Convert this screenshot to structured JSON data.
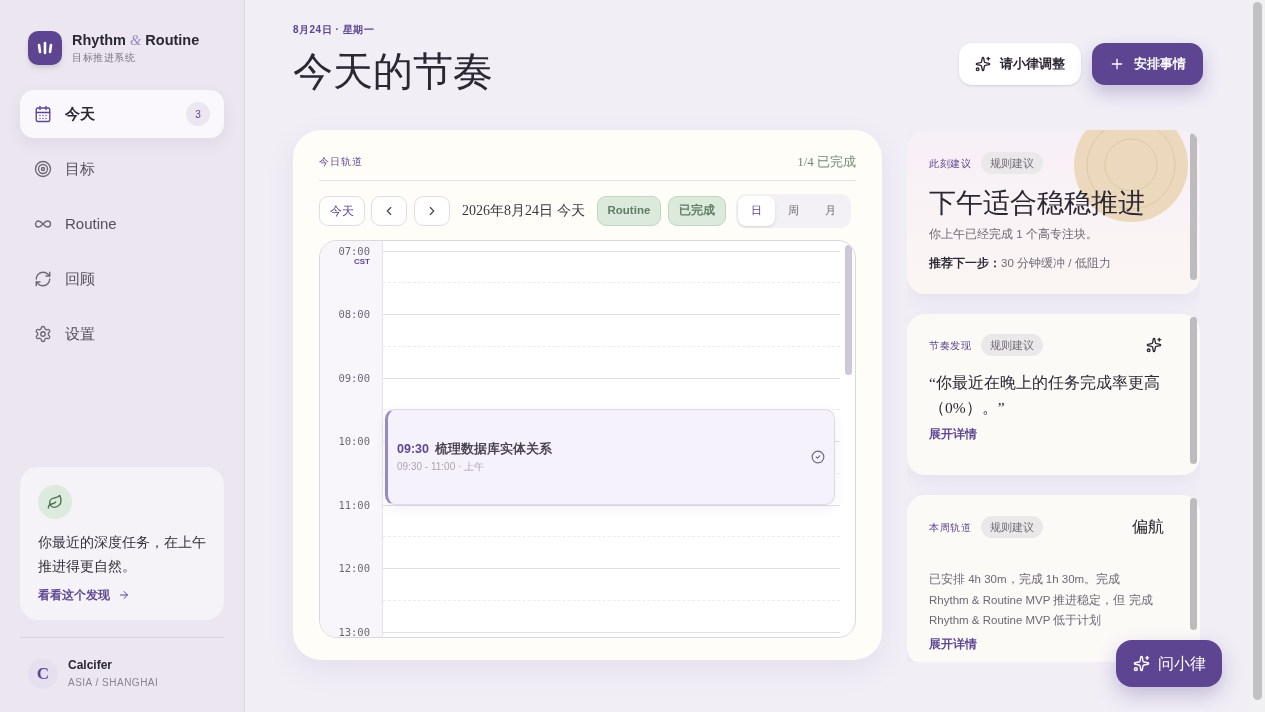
{
  "sidebar": {
    "brand": {
      "name_start": "Rhythm",
      "ampersand": "&",
      "name_end": "Routine",
      "subtitle": "目标推进系统"
    },
    "nav": [
      {
        "label": "今天",
        "badge": "3",
        "selected": true
      },
      {
        "label": "目标",
        "selected": false
      },
      {
        "label": "Routine",
        "selected": false
      },
      {
        "label": "回顾",
        "selected": false
      },
      {
        "label": "设置",
        "selected": false
      }
    ],
    "insight": {
      "text": "你最近的深度任务，在上午推进得更自然。",
      "link": "看看这个发现"
    },
    "user": {
      "initial": "C",
      "name": "Calcifer",
      "timezone": "ASIA / SHANGHAI"
    }
  },
  "header": {
    "date_line": "8月24日 · 星期一",
    "title": "今天的节奏",
    "buttons": [
      {
        "kind": "secondary",
        "label": "请小律调整"
      },
      {
        "kind": "primary",
        "label": "安排事情"
      }
    ]
  },
  "calendar": {
    "section_title": "今日轨道",
    "progress": "1/4 已完成",
    "today_button": "今天",
    "date": "2026年8月24日 今天",
    "filters": [
      "Routine",
      "已完成"
    ],
    "views": [
      {
        "label": "日",
        "selected": true
      },
      {
        "label": "周",
        "selected": false
      },
      {
        "label": "月",
        "selected": false
      }
    ],
    "timezone": "CST",
    "hours": [
      "07:00",
      "08:00",
      "09:00",
      "10:00",
      "11:00",
      "12:00",
      "13:00"
    ],
    "events": [
      {
        "time": "09:30",
        "title": "梳理数据库实体关系",
        "detail": "09:30 - 11:00 · 上午"
      }
    ]
  },
  "cards": [
    {
      "kind": "suggestion",
      "label": "此刻建议",
      "tag": "规则建议",
      "headline": "下午适合稳稳推进",
      "body": "你上午已经完成 1 个高专注块。",
      "next_label": "推荐下一步：",
      "next_text": "30 分钟缓冲 / 低阻力"
    },
    {
      "kind": "finding",
      "label": "节奏发现",
      "tag": "规则建议",
      "quote": "“你最近在晚上的任务完成率更高（0%）。”",
      "link": "展开详情"
    },
    {
      "kind": "week",
      "label": "本周轨道",
      "tag": "规则建议",
      "status": "偏航",
      "body": "已安排 4h 30m，完成 1h 30m。完成 Rhythm & Routine MVP 推进稳定，但 完成 Rhythm & Routine MVP 低于计划",
      "link": "展开详情"
    }
  ],
  "ask_button": "问小律"
}
